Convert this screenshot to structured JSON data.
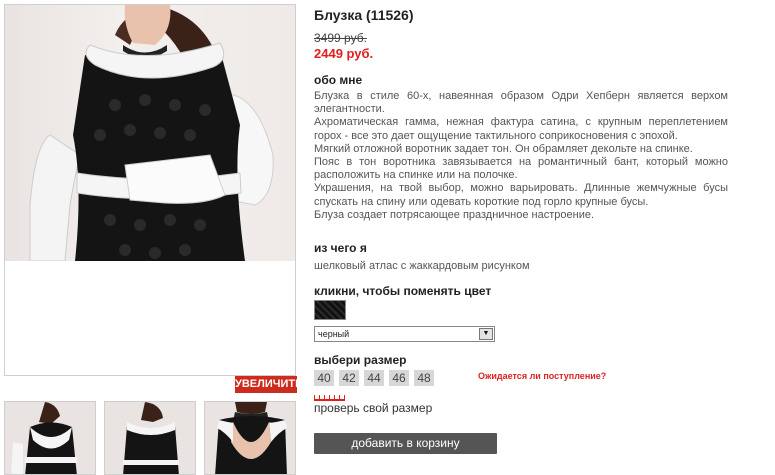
{
  "product": {
    "title": "Блузка (11526)",
    "old_price": "3499 руб.",
    "new_price": "2449 руб."
  },
  "gallery": {
    "enlarge_label": "УВЕЛИЧИТЬ"
  },
  "about": {
    "heading": "обо мне",
    "paragraphs": [
      "Блузка в стиле 60-х, навеянная образом Одри Хепберн является верхом элегантности.",
      "Ахроматическая гамма, нежная фактура сатина, с крупным переплетением горох - все это дает ощущение тактильного соприкосновения с эпохой.",
      "Мягкий отложной воротник задает тон. Он обрамляет декольте на спинке.",
      "Пояс в тон воротника завязывается на романтичный бант, который можно расположить на спинке или на полочке.",
      "Украшения, на твой выбор, можно варьировать. Длинные жемчужные бусы спускать на спину или одевать короткие под горло крупные бусы.",
      "Блуза создает потрясающее праздничное настроение."
    ]
  },
  "material": {
    "heading": "из чего я",
    "text": "шелковый атлас с жаккардовым рисунком"
  },
  "color": {
    "heading": "кликни, чтобы поменять цвет",
    "selected": "черный",
    "swatch_color": "#111111"
  },
  "size": {
    "heading": "выбери размер",
    "options": [
      "40",
      "42",
      "44",
      "46",
      "48"
    ],
    "await_link": "Ожидается ли поступление?",
    "check_link": "проверь свой размер"
  },
  "cart": {
    "add_label": "добавить в корзину"
  },
  "colors": {
    "accent_red": "#cc2b1d",
    "price_red": "#e02020",
    "button_gray": "#555555"
  }
}
